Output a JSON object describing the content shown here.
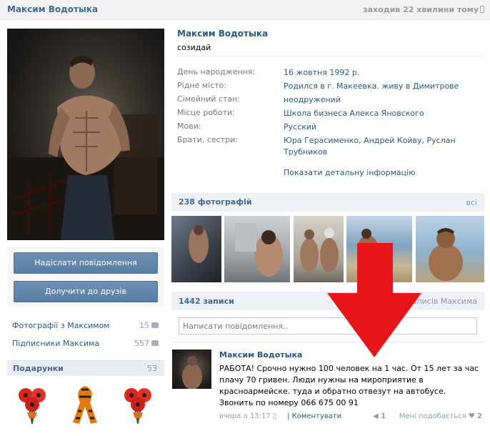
{
  "header": {
    "name": "Максим Водотыка",
    "last_seen": "заходив 22 хвилини тому"
  },
  "profile": {
    "name": "Максим Водотыка",
    "status": "созидай",
    "fields": [
      {
        "label": "День народження:",
        "value": "16 жовтня 1992 р."
      },
      {
        "label": "Рідне місто:",
        "value": "Родился в г. Макеевка. живу в Димитрове"
      },
      {
        "label": "Сімейний стан:",
        "value": "неодружений"
      },
      {
        "label": "Місце роботи:",
        "value": "Школа бизнеса Алекса Яновского"
      },
      {
        "label": "Мови:",
        "value": "Русский"
      },
      {
        "label": "Брати, сестри:",
        "value": "Юра Герасименко, Андрей Койву, Руслан Трубников"
      }
    ],
    "more_link": "Показати детальну інформацію"
  },
  "actions": {
    "send_message": "Надіслати повідомлення",
    "add_friend": "Долучити до друзів"
  },
  "side_links": [
    {
      "label": "Фотографії з Максимом",
      "count": "15",
      "icon": "camera-icon"
    },
    {
      "label": "Підписники Максима",
      "count": "557",
      "icon": "people-icon"
    }
  ],
  "gifts": {
    "title": "Подарунки",
    "count": "53",
    "items": [
      "poppy-bouquet",
      "st-george-ribbon",
      "poppy-bouquet"
    ]
  },
  "photos": {
    "title": "238 фотографій",
    "all_link": "всі"
  },
  "posts": {
    "title": "1442 записи",
    "to_link": "до записів Максима",
    "placeholder": "Написати повідомлення.."
  },
  "post": {
    "author": "Максим Водотыка",
    "text": "РАБОТА! Срочно нужно 100 человек на 1 час. От 15 лет за час плачу 70 гривен. Люди нужны на мироприятие в красноармейске. туда и обратно отвезут на автобусе. Звонить по номеру 066 675 00 91",
    "time": "вчора о 13:17",
    "comment_link": "Коментувати",
    "shares": "1",
    "like_label": "Мені подобається",
    "likes": "2"
  },
  "colors": {
    "link": "#2b587a",
    "header_bg": "#edf1f5",
    "button": "#5f82a8",
    "arrow": "#e8161b"
  }
}
